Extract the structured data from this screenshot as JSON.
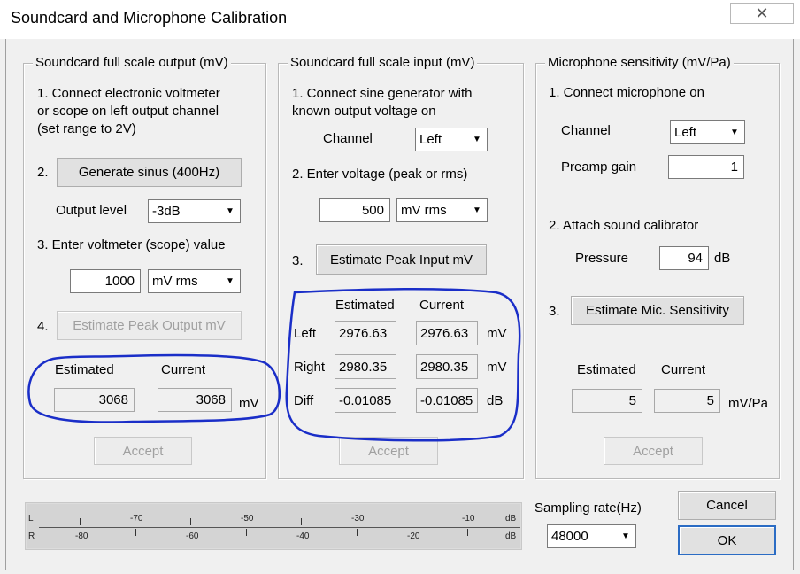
{
  "window": {
    "title": "Soundcard and Microphone Calibration"
  },
  "output_group": {
    "legend": "Soundcard full scale output (mV)",
    "step1_line1": "1. Connect electronic voltmeter",
    "step1_line2": "or scope on left output channel",
    "step1_line3": "(set range  to 2V)",
    "step2_num": "2.",
    "generate_label": "Generate sinus (400Hz)",
    "output_level_label": "Output level",
    "output_level_value": "-3dB",
    "step3_label": "3. Enter voltmeter (scope) value",
    "voltmeter_value": "1000",
    "voltmeter_unit": "mV rms",
    "step4_num": "4.",
    "estimate_label": "Estimate Peak Output mV",
    "estimated_header": "Estimated",
    "current_header": "Current",
    "estimated_value": "3068",
    "current_value": "3068",
    "unit": "mV",
    "accept_label": "Accept"
  },
  "input_group": {
    "legend": "Soundcard full scale  input (mV)",
    "step1_line1": "1. Connect sine generator with",
    "step1_line2": "known output voltage on",
    "channel_label": "Channel",
    "channel_value": "Left",
    "step2_label": "2. Enter voltage (peak or rms)",
    "voltage_value": "500",
    "voltage_unit": "mV rms",
    "step3_num": "3.",
    "estimate_label": "Estimate Peak Input mV",
    "estimated_header": "Estimated",
    "current_header": "Current",
    "rows": [
      {
        "label": "Left",
        "estimated": "2976.63",
        "current": "2976.63",
        "unit": "mV"
      },
      {
        "label": "Right",
        "estimated": "2980.35",
        "current": "2980.35",
        "unit": "mV"
      },
      {
        "label": "Diff",
        "estimated": "-0.01085",
        "current": "-0.01085",
        "unit": "dB"
      }
    ],
    "accept_label": "Accept"
  },
  "mic_group": {
    "legend": "Microphone sensitivity (mV/Pa)",
    "step1_label": "1. Connect microphone on",
    "channel_label": "Channel",
    "channel_value": "Left",
    "preamp_label": "Preamp  gain",
    "preamp_value": "1",
    "step2_label": "2. Attach sound calibrator",
    "pressure_label": "Pressure",
    "pressure_value": "94",
    "pressure_unit": "dB",
    "step3_num": "3.",
    "estimate_label": "Estimate Mic. Sensitivity",
    "estimated_header": "Estimated",
    "current_header": "Current",
    "estimated_value": "5",
    "current_value": "5",
    "unit": "mV/Pa",
    "accept_label": "Accept"
  },
  "meter": {
    "L_label": "L",
    "R_label": "R",
    "top_ticks": [
      "-70",
      "-50",
      "-30",
      "-10"
    ],
    "bottom_ticks": [
      "-80",
      "-60",
      "-40",
      "-20"
    ],
    "db_label": "dB"
  },
  "sampling": {
    "label": "Sampling rate(Hz)",
    "value": "48000"
  },
  "buttons": {
    "cancel": "Cancel",
    "ok": "OK",
    "close_glyph": "✕"
  },
  "icons": {
    "close": "close-icon",
    "dropdown": "chevron-down-icon"
  },
  "colors": {
    "annotation": "#1a2ec8",
    "default_button_border": "#2b6cc4"
  }
}
